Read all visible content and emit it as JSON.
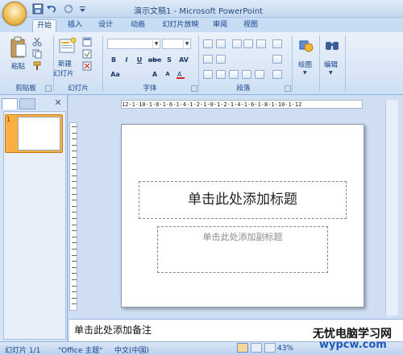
{
  "window": {
    "title": "演示文稿1 - Microsoft PowerPoint"
  },
  "quick_access": {
    "icons": [
      "save-icon",
      "undo-icon",
      "redo-icon",
      "customize-icon"
    ]
  },
  "tabs": [
    {
      "label": "开始",
      "active": true
    },
    {
      "label": "插入",
      "active": false
    },
    {
      "label": "设计",
      "active": false
    },
    {
      "label": "动画",
      "active": false
    },
    {
      "label": "幻灯片放映",
      "active": false
    },
    {
      "label": "审阅",
      "active": false
    },
    {
      "label": "视图",
      "active": false
    }
  ],
  "ribbon": {
    "clipboard": {
      "label": "剪贴板",
      "paste_label": "粘贴"
    },
    "slides": {
      "label": "幻灯片",
      "new_slide_label": "新建",
      "new_slide_label2": "幻灯片"
    },
    "font": {
      "label": "字体",
      "buttons": [
        "B",
        "I",
        "U",
        "abe",
        "S",
        "AV",
        "Aa",
        "A",
        "A"
      ]
    },
    "paragraph": {
      "label": "段落"
    },
    "drawing": {
      "label": "绘图"
    },
    "editing": {
      "label": "编辑"
    }
  },
  "editor": {
    "ruler_text": "12·1·10·1·8·1·6·1·4·1·2·1·0·1·2·1·4·1·6·1·8·1·10·1·12",
    "title_placeholder": "单击此处添加标题",
    "subtitle_placeholder": "单击此处添加副标题",
    "notes_placeholder": "单击此处添加备注",
    "thumbnail_number": "1"
  },
  "status": {
    "slide": "幻灯片 1/1",
    "theme": "\"Office 主题\"",
    "language": "中文(中国)",
    "zoom": "43%"
  },
  "watermark": {
    "main": "无忧电脑学习网",
    "sub": "wypcw.com"
  },
  "colors": {
    "accent": "#15428b",
    "ribbon_bg": "#dbe7f6",
    "selection": "#f8b043"
  }
}
